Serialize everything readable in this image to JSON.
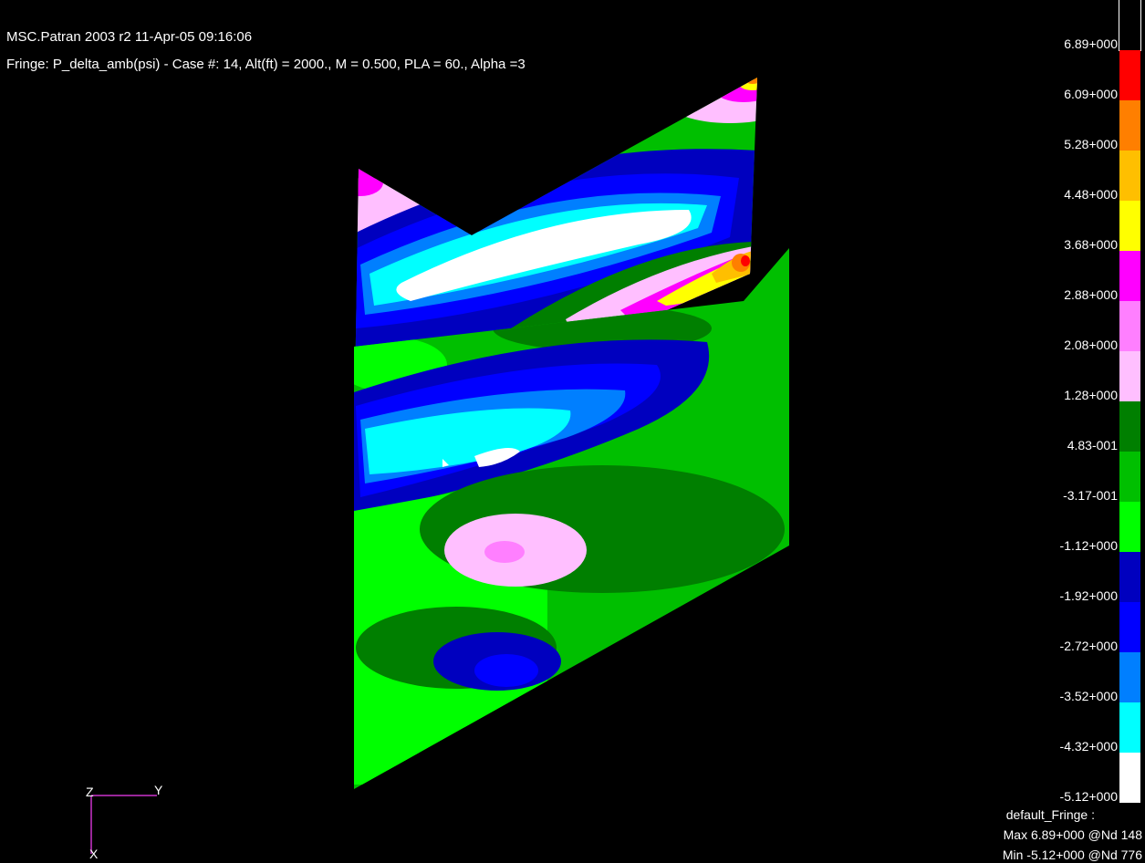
{
  "header": {
    "title": "MSC.Patran 2003 r2 11-Apr-05 09:16:06",
    "fringe": "Fringe: P_delta_amb(psi) - Case #:  14, Alt(ft) = 2000., M = 0.500, PLA = 60., Alpha =3"
  },
  "legend": {
    "colors": [
      "#000000",
      "#ff0000",
      "#ff7f00",
      "#ffbf00",
      "#ffff00",
      "#ff00ff",
      "#ff7fff",
      "#ffbfff",
      "#007f00",
      "#00bf00",
      "#00ff00",
      "#0000bf",
      "#0000ff",
      "#007fff",
      "#00ffff",
      "#ffffff"
    ],
    "labels": [
      "6.89+000",
      "6.09+000",
      "5.28+000",
      "4.48+000",
      "3.68+000",
      "2.88+000",
      "2.08+000",
      "1.28+000",
      "4.83-001",
      "-3.17-001",
      "-1.12+000",
      "-1.92+000",
      "-2.72+000",
      "-3.52+000",
      "-4.32+000",
      "-5.12+000"
    ]
  },
  "footer": {
    "name": "default_Fringe :",
    "max": "Max 6.89+000 @Nd 148",
    "min": "Min -5.12+000 @Nd 776"
  },
  "axes": {
    "z": "Z",
    "y": "Y",
    "x": "X",
    "color": "#cc33cc"
  }
}
